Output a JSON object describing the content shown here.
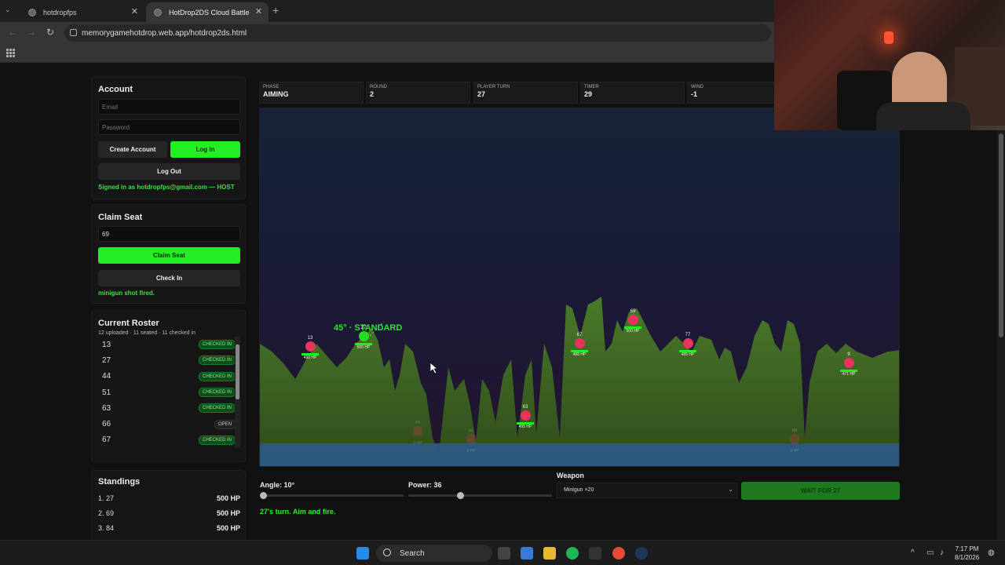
{
  "browser": {
    "tabs": [
      {
        "title": "hotdropfps"
      },
      {
        "title": "HotDrop2DS Cloud Battle"
      }
    ],
    "url": "memorygamehotdrop.web.app/hotdrop2ds.html"
  },
  "account": {
    "heading": "Account",
    "email_placeholder": "Email",
    "password_placeholder": "Password",
    "create_label": "Create Account",
    "login_label": "Log In",
    "logout_label": "Log Out",
    "status": "Signed in as hotdropfps@gmail.com — HOST"
  },
  "seat": {
    "heading": "Claim Seat",
    "value": "69",
    "claim_label": "Claim Seat",
    "checkin_label": "Check In",
    "status": "minigun shot fired."
  },
  "roster": {
    "heading": "Current Roster",
    "summary": "12 uploaded · 11 seated · 11 checked in",
    "rows": [
      {
        "num": "13",
        "status": "CHECKED IN"
      },
      {
        "num": "27",
        "status": "CHECKED IN"
      },
      {
        "num": "44",
        "status": "CHECKED IN"
      },
      {
        "num": "51",
        "status": "CHECKED IN"
      },
      {
        "num": "63",
        "status": "CHECKED IN"
      },
      {
        "num": "66",
        "status": "OPEN"
      },
      {
        "num": "67",
        "status": "CHECKED IN"
      }
    ]
  },
  "standings": {
    "heading": "Standings",
    "rows": [
      {
        "rank": "1. 27",
        "hp": "500 HP"
      },
      {
        "rank": "2. 69",
        "hp": "500 HP"
      },
      {
        "rank": "3. 84",
        "hp": "500 HP"
      }
    ]
  },
  "hud": [
    {
      "label": "PHASE",
      "value": "AIMING"
    },
    {
      "label": "ROUND",
      "value": "2"
    },
    {
      "label": "PLAYER TURN",
      "value": "27"
    },
    {
      "label": "TIMER",
      "value": "29"
    },
    {
      "label": "WIND",
      "value": "-1"
    }
  ],
  "aim_label": "45° · STANDARD",
  "units": [
    {
      "num": "13",
      "hp": "490 HP",
      "me": false,
      "dim": false
    },
    {
      "num": "27",
      "hp": "500 HP",
      "me": true,
      "dim": false
    },
    {
      "num": "44",
      "hp": "0 HP",
      "me": false,
      "dim": true
    },
    {
      "num": "51",
      "hp": "0 HP",
      "me": false,
      "dim": true
    },
    {
      "num": "63",
      "hp": "495 HP",
      "me": false,
      "dim": false
    },
    {
      "num": "67",
      "hp": "488 HP",
      "me": false,
      "dim": false
    },
    {
      "num": "69",
      "hp": "500 HP",
      "me": false,
      "dim": false
    },
    {
      "num": "77",
      "hp": "485 HP",
      "me": false,
      "dim": false
    },
    {
      "num": "88",
      "hp": "0 HP",
      "me": false,
      "dim": true
    },
    {
      "num": "9",
      "hp": "471 HP",
      "me": false,
      "dim": false
    }
  ],
  "controls": {
    "angle_label": "Angle: 10°",
    "angle_value": 10,
    "power_label": "Power: 36",
    "power_value": 36,
    "weapon_heading": "Weapon",
    "weapon_value": "Minigun ×20",
    "fire_label": "WAIT FOR 27",
    "turn_message": "27's turn. Aim and fire."
  },
  "taskbar": {
    "search_label": "Search",
    "time": "7:17 PM",
    "date": "8/1/2026"
  },
  "colors": {
    "accent": "#22ee22",
    "enemy": "#e8335e",
    "water": "#2f5a8a",
    "terrain": "#4a7a2a"
  }
}
